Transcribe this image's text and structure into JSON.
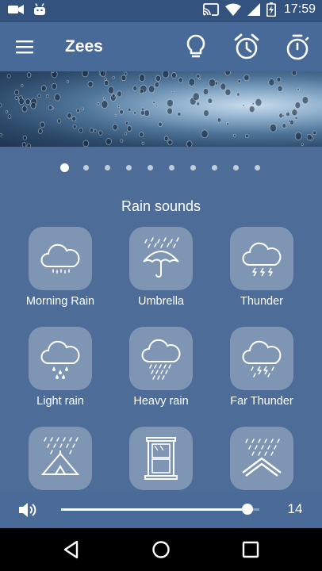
{
  "status_bar": {
    "time": "17:59",
    "icons": [
      "video-camera-icon",
      "android-icon",
      "cast-icon",
      "wifi-icon",
      "signal-icon",
      "battery-charging-icon"
    ]
  },
  "app_bar": {
    "title": "Zees",
    "icons": [
      "menu-icon",
      "lightbulb-icon",
      "alarm-clock-icon",
      "stopwatch-icon"
    ]
  },
  "carousel": {
    "page_count": 10,
    "active_index": 0
  },
  "section": {
    "title": "Rain sounds"
  },
  "sounds": [
    {
      "label": "Morning Rain",
      "icon": "cloud-drizzle-icon"
    },
    {
      "label": "Umbrella",
      "icon": "umbrella-rain-icon"
    },
    {
      "label": "Thunder",
      "icon": "cloud-thunder-icon"
    },
    {
      "label": "Light rain",
      "icon": "cloud-light-rain-icon"
    },
    {
      "label": "Heavy rain",
      "icon": "cloud-heavy-rain-icon"
    },
    {
      "label": "Far Thunder",
      "icon": "cloud-far-thunder-icon"
    },
    {
      "label": "",
      "icon": "tent-rain-icon"
    },
    {
      "label": "",
      "icon": "window-rain-icon"
    },
    {
      "label": "",
      "icon": "roof-rain-icon"
    }
  ],
  "volume": {
    "value": "14",
    "level": 0.94,
    "icon": "speaker-icon"
  },
  "nav_bar": {
    "icons": [
      "back-icon",
      "home-icon",
      "recents-icon"
    ]
  },
  "colors": {
    "background": "#4d6d98",
    "app_bar": "#476a98",
    "status_bar": "#33527d",
    "nav_bar": "#000000"
  }
}
